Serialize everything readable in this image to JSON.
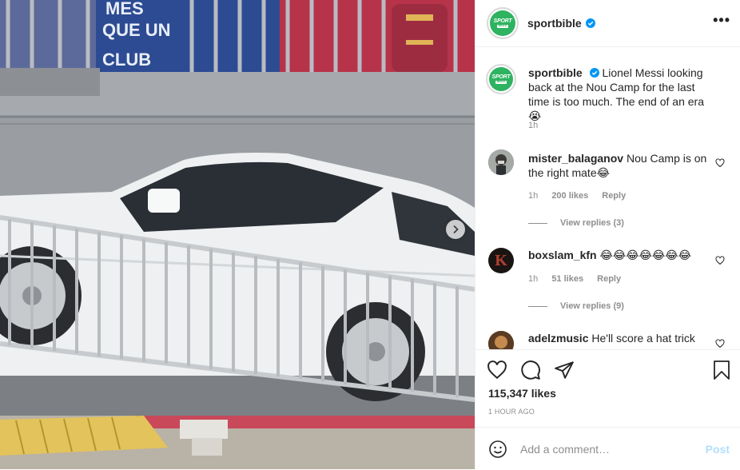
{
  "colors": {
    "accent": "#0095f6",
    "post_disabled": "#b2dffc",
    "brand_green": "#2eb360",
    "muted": "#8e8e8e"
  },
  "media": {
    "sign_lines": [
      "MES",
      "QUE UN",
      "CLUB"
    ],
    "next_icon": "chevron-right-icon"
  },
  "header": {
    "username": "sportbible",
    "logo_line1": "SPORT",
    "logo_line2": "BIBLE",
    "more_icon": "more-options-icon"
  },
  "caption": {
    "username": "sportbible",
    "text": "Lionel Messi looking back at the Nou Camp for the last time is too much. The end of an era 😭",
    "time": "1h"
  },
  "comments": [
    {
      "username": "mister_balaganov",
      "text": "Nou Camp is on the right mate😂",
      "time": "1h",
      "likes": "200 likes",
      "reply": "Reply",
      "replies": "View replies (3)"
    },
    {
      "username": "boxslam_kfn",
      "text": "😂😂😂😂😂😂😂",
      "time": "1h",
      "likes": "51 likes",
      "reply": "Reply",
      "replies": "View replies (9)",
      "avatar_letter": "K"
    },
    {
      "username": "adelzmusic",
      "text": "He'll score a hat trick"
    }
  ],
  "footer": {
    "likes": "115,347 likes",
    "time_ago": "1 HOUR AGO",
    "comment_placeholder": "Add a comment…",
    "post_label": "Post",
    "icons": [
      "heart-icon",
      "comment-icon",
      "share-icon",
      "bookmark-icon",
      "emoji-icon"
    ]
  }
}
